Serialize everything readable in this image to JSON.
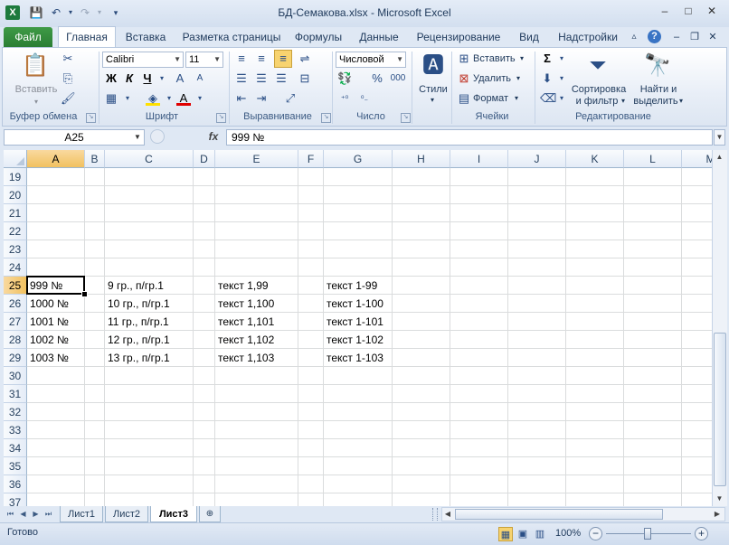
{
  "window": {
    "title": "БД-Семакова.xlsx - Microsoft Excel",
    "app_icon": "X",
    "controls": {
      "minimize": "–",
      "maximize": "□",
      "close": "✕"
    }
  },
  "quick_access": {
    "save": "💾",
    "undo": "↶",
    "redo": "↷",
    "customize": "▾"
  },
  "tabs": [
    {
      "label": "Файл"
    },
    {
      "label": "Главная"
    },
    {
      "label": "Вставка"
    },
    {
      "label": "Разметка страницы"
    },
    {
      "label": "Формулы"
    },
    {
      "label": "Данные"
    },
    {
      "label": "Рецензирование"
    },
    {
      "label": "Вид"
    },
    {
      "label": "Надстройки"
    }
  ],
  "ribbon": {
    "clipboard": {
      "label": "Буфер обмена",
      "paste": "Вставить"
    },
    "font": {
      "label": "Шрифт",
      "name": "Calibri",
      "size": "11",
      "bold": "Ж",
      "italic": "К",
      "underline": "Ч"
    },
    "alignment": {
      "label": "Выравнивание"
    },
    "number": {
      "label": "Число",
      "format": "Числовой",
      "percent": "%",
      "thousands": "000"
    },
    "styles": {
      "label": "Стили"
    },
    "cells": {
      "label": "Ячейки",
      "insert": "Вставить",
      "delete": "Удалить",
      "format": "Формат"
    },
    "editing": {
      "label": "Редактирование",
      "sort_line1": "Сортировка",
      "sort_line2": "и фильтр",
      "find_line1": "Найти и",
      "find_line2": "выделить"
    }
  },
  "formula_bar": {
    "name_box": "A25",
    "fx": "fx",
    "value": "999 №"
  },
  "grid": {
    "columns": [
      "A",
      "B",
      "C",
      "D",
      "E",
      "F",
      "G",
      "H",
      "I",
      "J",
      "K",
      "L",
      "M"
    ],
    "selected_column": "A",
    "rows": [
      "19",
      "20",
      "21",
      "22",
      "23",
      "24",
      "25",
      "26",
      "27",
      "28",
      "29",
      "30",
      "31",
      "32",
      "33",
      "34",
      "35",
      "36",
      "37"
    ],
    "selected_row": "25",
    "data": [
      {
        "a": "999 №",
        "c": "9 гр., п/гр.1",
        "e": "текст 1,99",
        "g": "текст 1-99"
      },
      {
        "a": "1000 №",
        "c": "10 гр., п/гр.1",
        "e": "текст 1,100",
        "g": "текст 1-100"
      },
      {
        "a": "1001 №",
        "c": "11 гр., п/гр.1",
        "e": "текст 1,101",
        "g": "текст 1-101"
      },
      {
        "a": "1002 №",
        "c": "12 гр., п/гр.1",
        "e": "текст 1,102",
        "g": "текст 1-102"
      },
      {
        "a": "1003 №",
        "c": "13 гр., п/гр.1",
        "e": "текст 1,103",
        "g": "текст 1-103"
      }
    ]
  },
  "sheets": [
    {
      "label": "Лист1"
    },
    {
      "label": "Лист2"
    },
    {
      "label": "Лист3"
    }
  ],
  "status": {
    "ready": "Готово",
    "zoom": "100%",
    "zoom_out": "−",
    "zoom_in": "+"
  }
}
